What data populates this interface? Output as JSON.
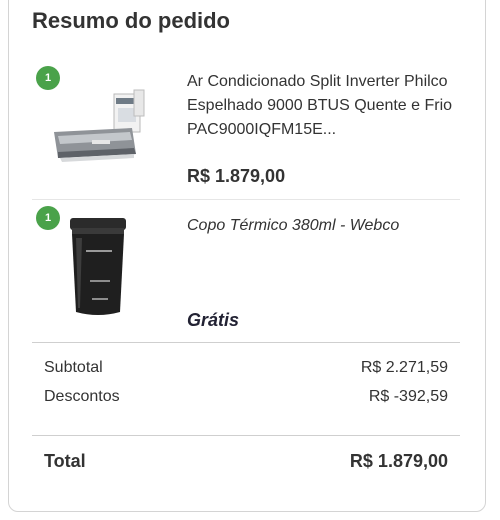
{
  "summary": {
    "title": "Resumo do pedido"
  },
  "items": [
    {
      "quantity": "1",
      "name": "Ar Condicionado Split Inverter Philco Espelhado 9000 BTUS Quente e Frio PAC9000IQFM15E...",
      "price": "R$ 1.879,00"
    },
    {
      "quantity": "1",
      "name": "Copo Térmico 380ml - Webco",
      "price": "Grátis"
    }
  ],
  "totals": {
    "subtotal_label": "Subtotal",
    "subtotal_value": "R$ 2.271,59",
    "discount_label": "Descontos",
    "discount_value": "R$ -392,59",
    "total_label": "Total",
    "total_value": "R$ 1.879,00"
  },
  "colors": {
    "badge": "#4aa24a",
    "text": "#333333",
    "border": "#d4d4d4"
  }
}
